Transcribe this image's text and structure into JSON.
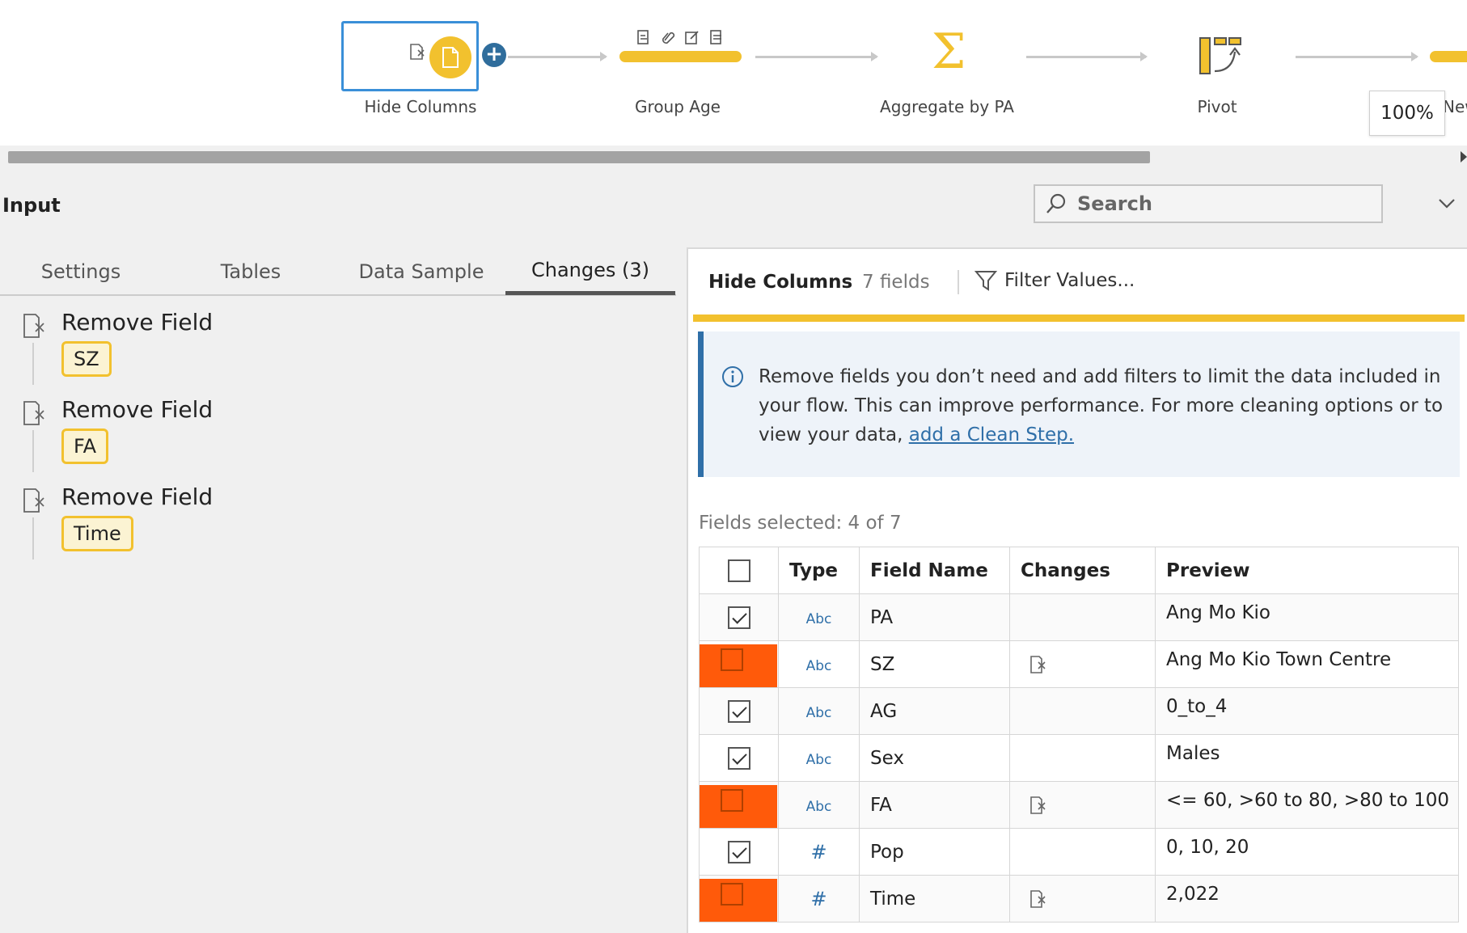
{
  "flow": {
    "nodes": [
      {
        "label": "Hide Columns"
      },
      {
        "label": "Group Age"
      },
      {
        "label": "Aggregate by PA"
      },
      {
        "label": "Pivot"
      },
      {
        "label": "New"
      }
    ],
    "zoom": "100%"
  },
  "input": {
    "title": "Input",
    "search_placeholder": "Search"
  },
  "tabs": [
    {
      "label": "Settings"
    },
    {
      "label": "Tables"
    },
    {
      "label": "Data Sample"
    },
    {
      "label": "Changes (3)",
      "active": true
    }
  ],
  "changes": [
    {
      "title": "Remove Field",
      "field": "SZ"
    },
    {
      "title": "Remove Field",
      "field": "FA"
    },
    {
      "title": "Remove Field",
      "field": "Time"
    }
  ],
  "panel": {
    "title": "Hide Columns",
    "count": "7 fields",
    "filter_label": "Filter Values...",
    "info_text": "Remove fields you don’t need and add filters to limit the data included in your flow. This can improve performance. For more cleaning options or to view your data, ",
    "info_link": "add a Clean Step.",
    "fields_selected": "Fields selected: 4 of 7",
    "columns": [
      "Type",
      "Field Name",
      "Changes",
      "Preview"
    ],
    "rows": [
      {
        "checked": true,
        "type": "Abc",
        "name": "PA",
        "changed": false,
        "preview": "Ang Mo Kio"
      },
      {
        "checked": false,
        "type": "Abc",
        "name": "SZ",
        "changed": true,
        "preview": "Ang Mo Kio Town Centre"
      },
      {
        "checked": true,
        "type": "Abc",
        "name": "AG",
        "changed": false,
        "preview": "0_to_4"
      },
      {
        "checked": true,
        "type": "Abc",
        "name": "Sex",
        "changed": false,
        "preview": "Males"
      },
      {
        "checked": false,
        "type": "Abc",
        "name": "FA",
        "changed": true,
        "preview": "<= 60, >60 to 80, >80 to 100"
      },
      {
        "checked": true,
        "type": "#",
        "name": "Pop",
        "changed": false,
        "preview": "0, 10, 20"
      },
      {
        "checked": false,
        "type": "#",
        "name": "Time",
        "changed": true,
        "preview": "2,022"
      }
    ]
  },
  "colors": {
    "accent_yellow": "#f2c12e",
    "selection_blue": "#3a8fd8",
    "link_blue": "#2f6fa8",
    "highlight_orange": "#ff5a0a"
  }
}
